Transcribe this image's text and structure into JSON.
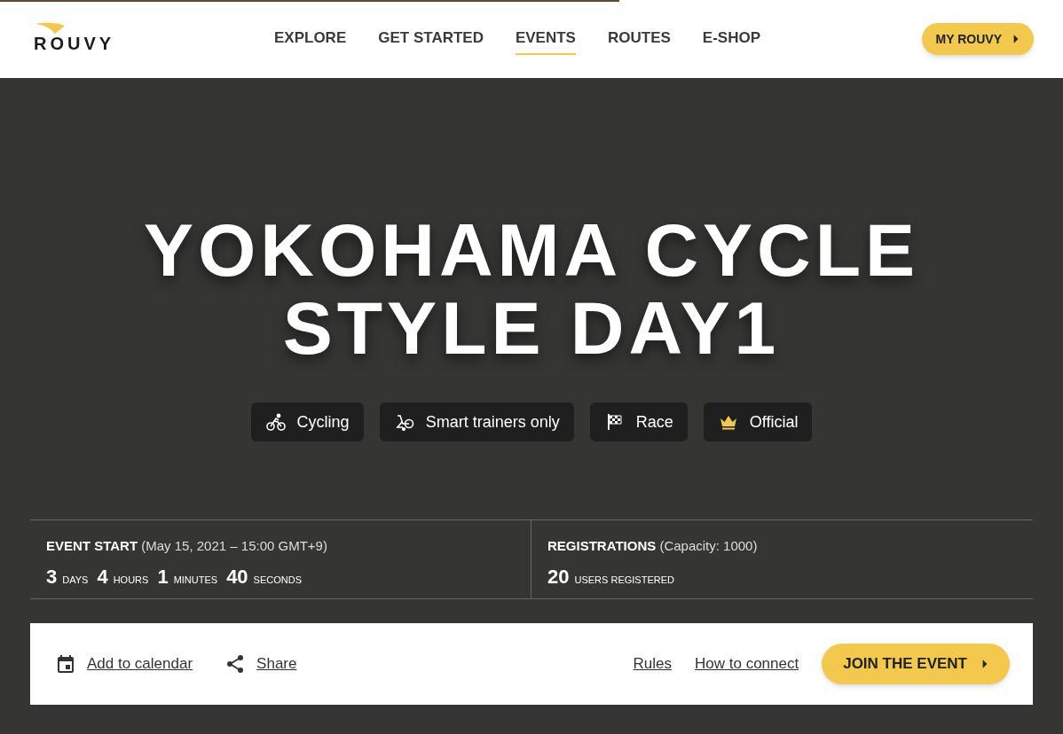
{
  "header": {
    "logo": "ROUVY",
    "nav": [
      {
        "label": "EXPLORE",
        "selected": false
      },
      {
        "label": "GET STARTED",
        "selected": false
      },
      {
        "label": "EVENTS",
        "selected": true
      },
      {
        "label": "ROUTES",
        "selected": false
      },
      {
        "label": "E-SHOP",
        "selected": false
      }
    ],
    "account_button": "MY ROUVY"
  },
  "hero": {
    "title_lines": [
      "YOKOHAMA CYCLE",
      "STYLE DAY1"
    ],
    "tags": [
      {
        "kind": "cycling",
        "label": "Cycling"
      },
      {
        "kind": "trainer",
        "label": "Smart trainers only"
      },
      {
        "kind": "race",
        "label": "Race"
      },
      {
        "kind": "official",
        "label": "Official"
      }
    ]
  },
  "stats": {
    "event_start": {
      "label": "EVENT START",
      "detail": "(May 15, 2021 – 15:00 GMT+9)",
      "countdown": [
        {
          "value": "3",
          "unit": "DAYS"
        },
        {
          "value": "4",
          "unit": "HOURS"
        },
        {
          "value": "1",
          "unit": "MINUTES"
        },
        {
          "value": "40",
          "unit": "SECONDS"
        }
      ]
    },
    "registrations": {
      "label": "REGISTRATIONS",
      "detail": "(Capacity: 1000)",
      "value": "20",
      "unit": "USERS REGISTERED"
    }
  },
  "action_bar": {
    "left_links": [
      {
        "kind": "calendar",
        "label": "Add to calendar"
      },
      {
        "kind": "share",
        "label": "Share"
      }
    ],
    "right_links": [
      "Rules",
      "How to connect"
    ],
    "join_button": "JOIN THE EVENT"
  }
}
